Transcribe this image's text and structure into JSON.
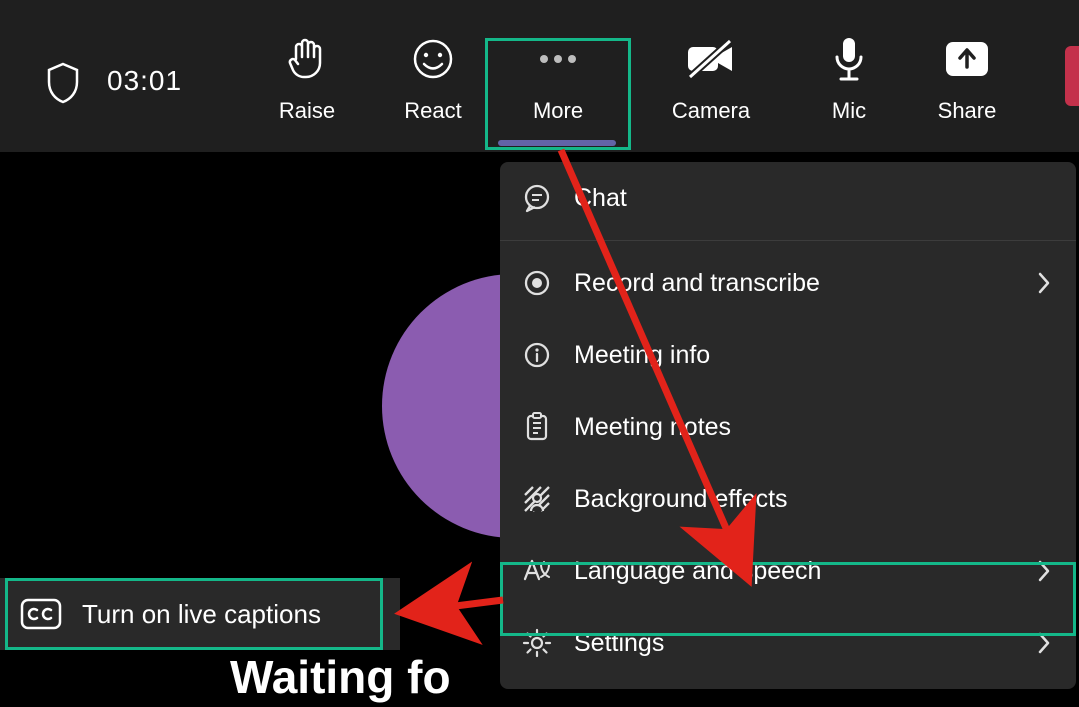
{
  "toolbar": {
    "elapsed_time": "03:01",
    "raise_label": "Raise",
    "react_label": "React",
    "more_label": "More",
    "camera_label": "Camera",
    "mic_label": "Mic",
    "share_label": "Share"
  },
  "captions_popup": {
    "label": "Turn on live captions"
  },
  "more_menu": {
    "chat": "Chat",
    "record": "Record and transcribe",
    "info": "Meeting info",
    "notes": "Meeting notes",
    "background": "Background effects",
    "language": "Language and speech",
    "settings": "Settings"
  },
  "main": {
    "waiting_text": "Waiting fo"
  }
}
